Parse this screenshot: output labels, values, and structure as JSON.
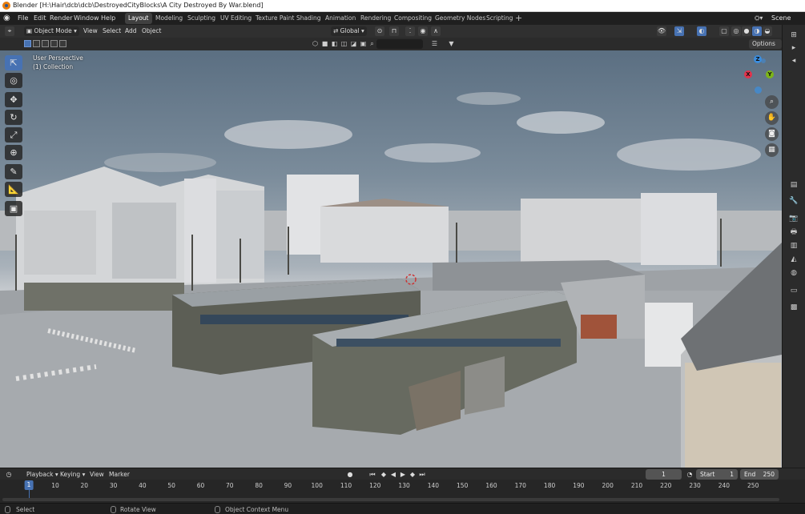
{
  "window": {
    "title": "Blender [H:\\Hair\\dcb\\dcb\\DestroyedCityBlocks\\A City Destroyed By War.blend]"
  },
  "menubar": {
    "menus": [
      "File",
      "Edit",
      "Render",
      "Window",
      "Help"
    ],
    "workspaces": [
      "Layout",
      "Modeling",
      "Sculpting",
      "UV Editing",
      "Texture Paint",
      "Shading",
      "Animation",
      "Rendering",
      "Compositing",
      "Geometry Nodes",
      "Scripting"
    ],
    "active_workspace": "Layout",
    "scene": "Scene"
  },
  "viewport_header": {
    "mode": "Object Mode",
    "menus": [
      "View",
      "Select",
      "Add",
      "Object"
    ],
    "transform_orientation": "Global",
    "options": "Options"
  },
  "viewport": {
    "perspective_label": "User Perspective",
    "collection_label": "(1) Collection",
    "gizmo_axes": {
      "z": "Z",
      "x": "X",
      "y": "Y"
    }
  },
  "timeline_header": {
    "menus": [
      "Playback",
      "Keying",
      "View",
      "Marker"
    ],
    "current_frame": "1",
    "start_label": "Start",
    "start_value": "1",
    "end_label": "End",
    "end_value": "250"
  },
  "timeline": {
    "current": "1",
    "ticks": [
      "10",
      "20",
      "30",
      "40",
      "50",
      "60",
      "70",
      "80",
      "90",
      "100",
      "110",
      "120",
      "130",
      "140",
      "150",
      "160",
      "170",
      "180",
      "190",
      "200",
      "210",
      "220",
      "230",
      "240",
      "250"
    ]
  },
  "statusbar": {
    "select": "Select",
    "rotate": "Rotate View",
    "context": "Object Context Menu"
  },
  "colors": {
    "accent": "#4772b3",
    "x_axis": "#e3324b",
    "y_axis": "#7cb518",
    "z_axis": "#3b8ee0"
  }
}
